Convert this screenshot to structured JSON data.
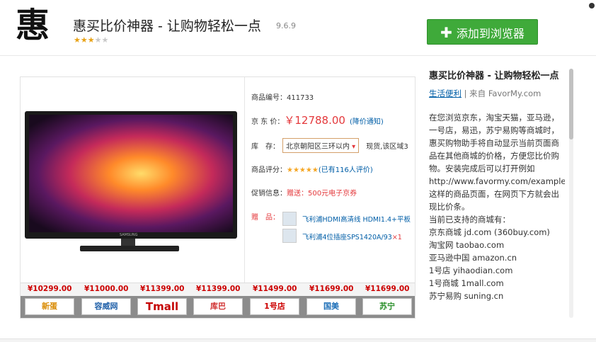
{
  "header": {
    "logo_char": "惠",
    "title": "惠买比价神器 - 让购物轻松一点",
    "version": "9.6.9",
    "rating_stars": 3,
    "add_button_label": "添加到浏览器"
  },
  "screenshot": {
    "tv_brand": "SAMSUNG",
    "product_code_label": "商品编号：",
    "product_code": "411733",
    "jd_price_label": "京 东 价：",
    "jd_price": "￥12788.00",
    "price_notice": "(降价通知)",
    "stock_label": "库　存：",
    "region": "北京朝阳区三环以内",
    "stock_note": "现货,该区域3",
    "score_label": "商品评分：",
    "score_stars": "★★★★★",
    "score_count": "(已有116人评价)",
    "promo_label": "促销信息：",
    "promo_text": "赠送：500元电子京券",
    "gift_label": "赠　品：",
    "gift_1": "飞利浦HDMI高清线 HDMI1.4+平板",
    "gift_2": "飞利浦4位插座SPS1420A/93",
    "gift_2_qty": "×1",
    "compare_prices": [
      "¥10299.00",
      "¥11000.00",
      "¥11399.00",
      "¥11399.00",
      "¥11499.00",
      "¥11699.00",
      "¥11699.00"
    ],
    "store_logos": [
      "新蛋",
      "容威网",
      "Tmall",
      "库巴",
      "1号店",
      "国美",
      "苏宁"
    ]
  },
  "description": {
    "title": "惠买比价神器 - 让购物轻松一点",
    "category": "生活便利",
    "source": "| 来自 FavorMy.com",
    "lines": [
      "在您浏览京东，淘宝天猫，亚马逊，一号店，易迅，苏宁易购等商城时，惠买购物助手将自动显示当前页面商品在其他商城的价格，方便您比价购物。安装完成后可以打开例如 http://www.favormy.com/example/ 这样的商品页面，在网页下方就会出现比价条。",
      "当前已支持的商城有：",
      "京东商城 jd.com (360buy.com)",
      "淘宝网 taobao.com",
      "亚马逊中国 amazon.cn",
      "1号店 yihaodian.com",
      "1号商城 1mall.com",
      "苏宁易购 suning.cn"
    ]
  }
}
